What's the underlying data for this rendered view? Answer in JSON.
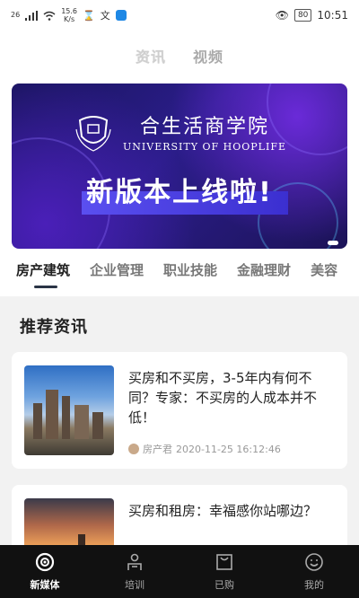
{
  "status_bar": {
    "signal": "26",
    "speed_value": "15.6",
    "speed_unit": "K/s",
    "battery": "80",
    "time": "10:51"
  },
  "top_tabs": [
    {
      "label": "资讯",
      "active": true
    },
    {
      "label": "视频",
      "active": false
    }
  ],
  "banner": {
    "school_name_cn": "合生活商学院",
    "school_name_en": "UNIVERSITY OF HOOPLIFE",
    "headline": "新版本上线啦!"
  },
  "categories": [
    {
      "label": "房产建筑",
      "active": true
    },
    {
      "label": "企业管理",
      "active": false
    },
    {
      "label": "职业技能",
      "active": false
    },
    {
      "label": "金融理财",
      "active": false
    },
    {
      "label": "美容",
      "active": false
    }
  ],
  "section_title": "推荐资讯",
  "articles": [
    {
      "title": "买房和不买房，3-5年内有何不同？专家：不买房的人成本并不低！",
      "author": "房产君",
      "time": "2020-11-25 16:12:46"
    },
    {
      "title": "买房和租房：幸福感你站哪边？",
      "author": "",
      "time": ""
    }
  ],
  "bottom_nav": [
    {
      "label": "新媒体",
      "icon": "media-icon",
      "active": true
    },
    {
      "label": "培训",
      "icon": "training-icon",
      "active": false
    },
    {
      "label": "已购",
      "icon": "purchased-icon",
      "active": false
    },
    {
      "label": "我的",
      "icon": "profile-icon",
      "active": false
    }
  ]
}
